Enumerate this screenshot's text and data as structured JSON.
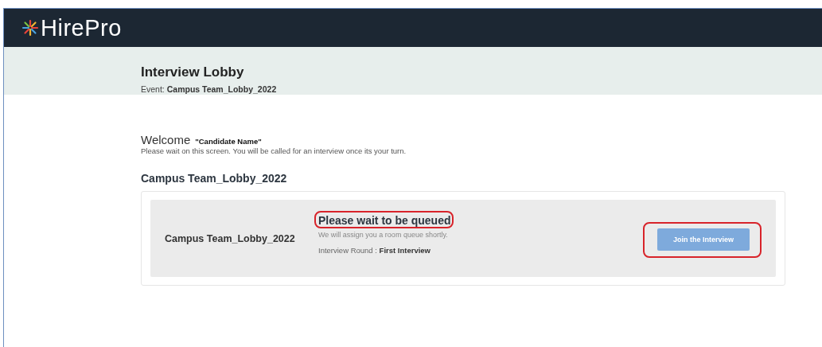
{
  "header": {
    "logo": "HirePro"
  },
  "lobby": {
    "title": "Interview Lobby",
    "event_label": "Event:",
    "event_name": "Campus Team_Lobby_2022"
  },
  "welcome": {
    "greeting": "Welcome",
    "candidate": "\"Candidate Name\"",
    "message": "Please wait on this screen. You will be called for an interview once its your turn."
  },
  "section_title": "Campus Team_Lobby_2022",
  "card": {
    "name": "Campus Team_Lobby_2022",
    "status": {
      "title": "Please wait to be queued",
      "highlighted": true
    },
    "note": "We will assign you a room queue shortly.",
    "round_label": "Interview Round :",
    "round_value": "First Interview",
    "button": {
      "label": "Join the Interview",
      "disabled": true,
      "highlighted": true
    }
  }
}
